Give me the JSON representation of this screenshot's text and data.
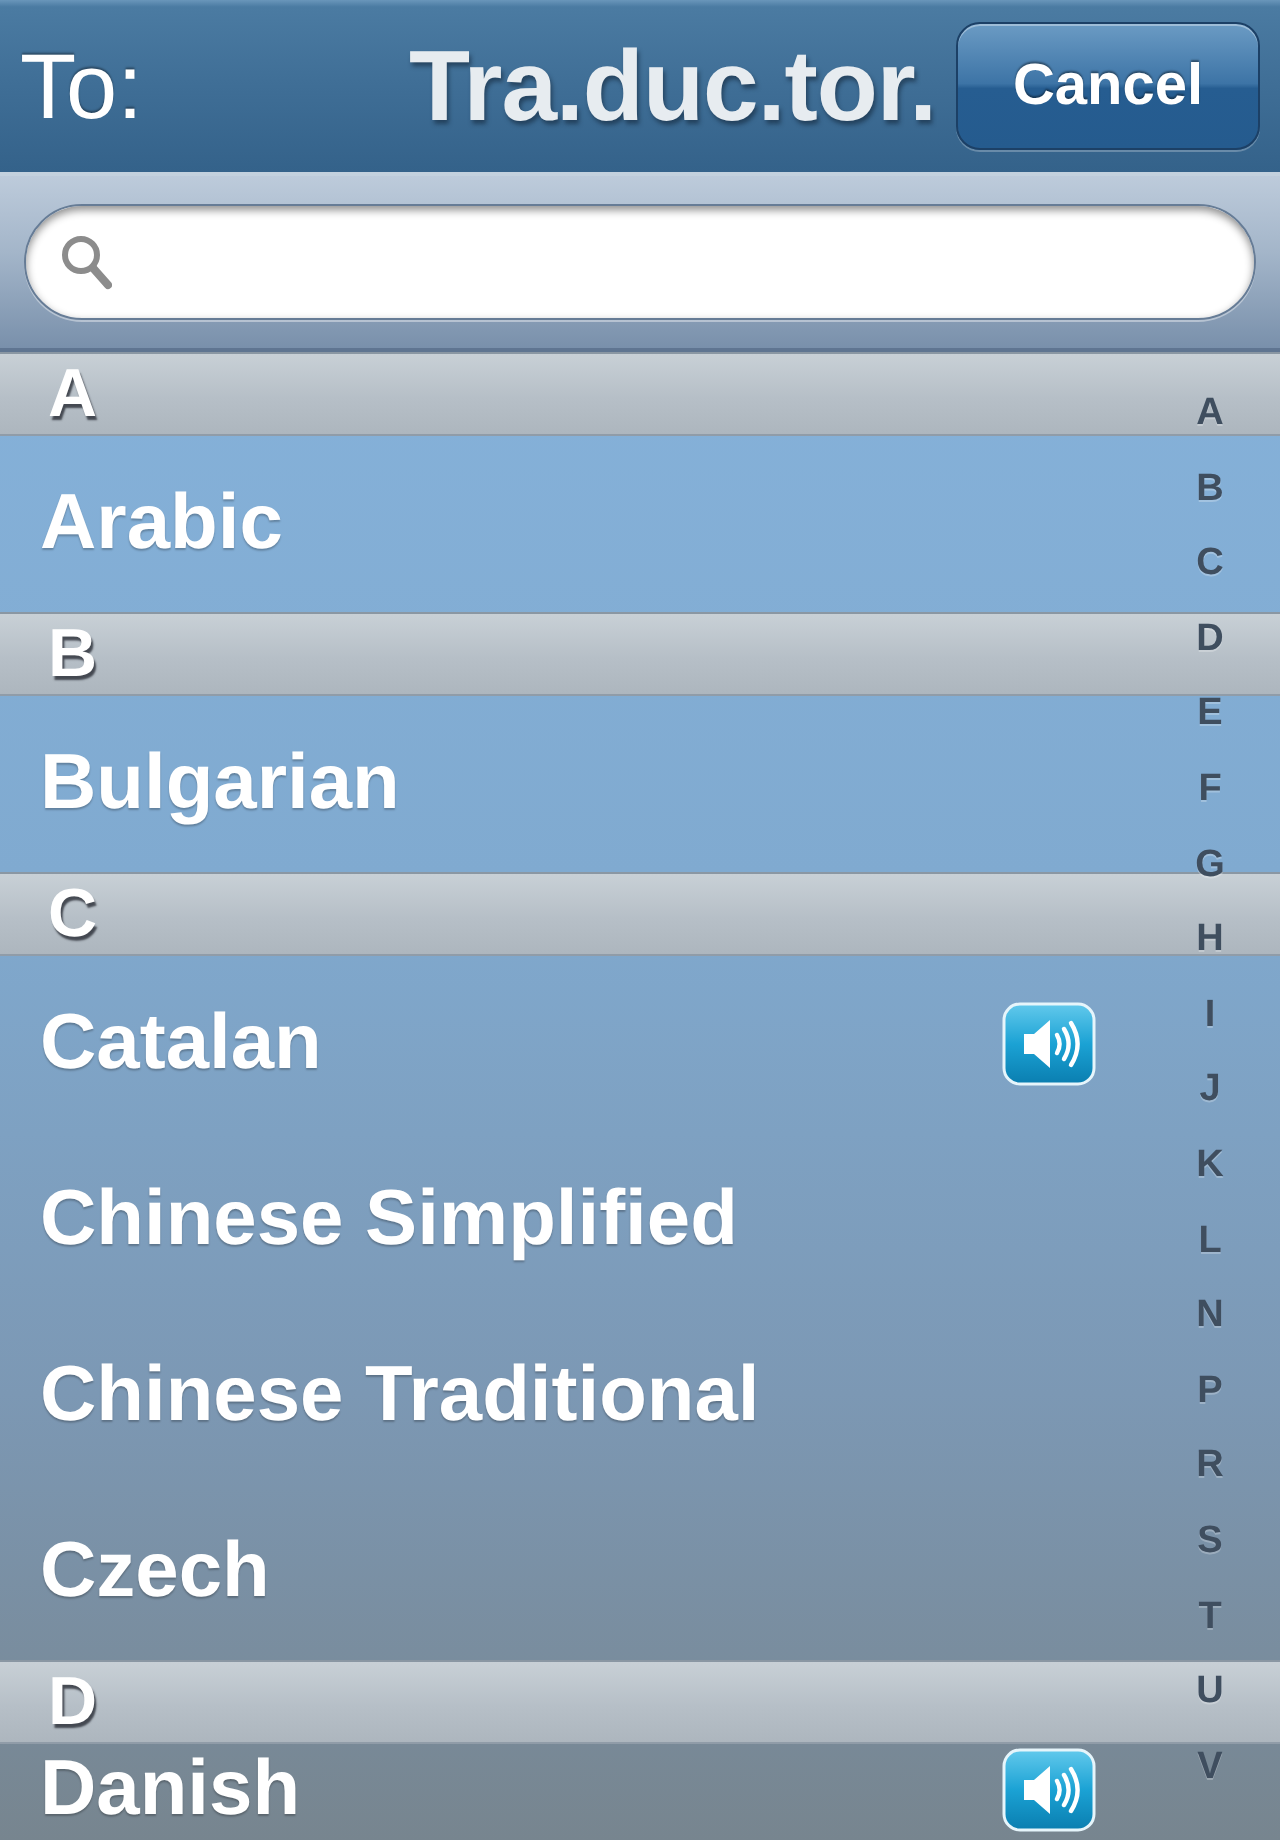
{
  "navigation_bar": {
    "title": "To:",
    "logo": "Tra.duc.tor.",
    "cancel_button": "Cancel"
  },
  "sections": [
    {
      "letter": "A",
      "languages": [
        {
          "name": "Arabic",
          "audio": false
        }
      ]
    },
    {
      "letter": "B",
      "languages": [
        {
          "name": "Bulgarian",
          "audio": false
        }
      ]
    },
    {
      "letter": "C",
      "languages": [
        {
          "name": "Catalan",
          "audio": true
        },
        {
          "name": "Chinese Simplified",
          "audio": false
        },
        {
          "name": "Chinese Traditional",
          "audio": false
        },
        {
          "name": "Czech",
          "audio": false
        }
      ]
    },
    {
      "letter": "D",
      "languages": [
        {
          "name": "Danish",
          "audio": true
        }
      ]
    }
  ],
  "section_index": [
    "A",
    "B",
    "C",
    "D",
    "E",
    "F",
    "G",
    "H",
    "I",
    "J",
    "K",
    "L",
    "N",
    "P",
    "R",
    "S",
    "T",
    "U",
    "V"
  ]
}
